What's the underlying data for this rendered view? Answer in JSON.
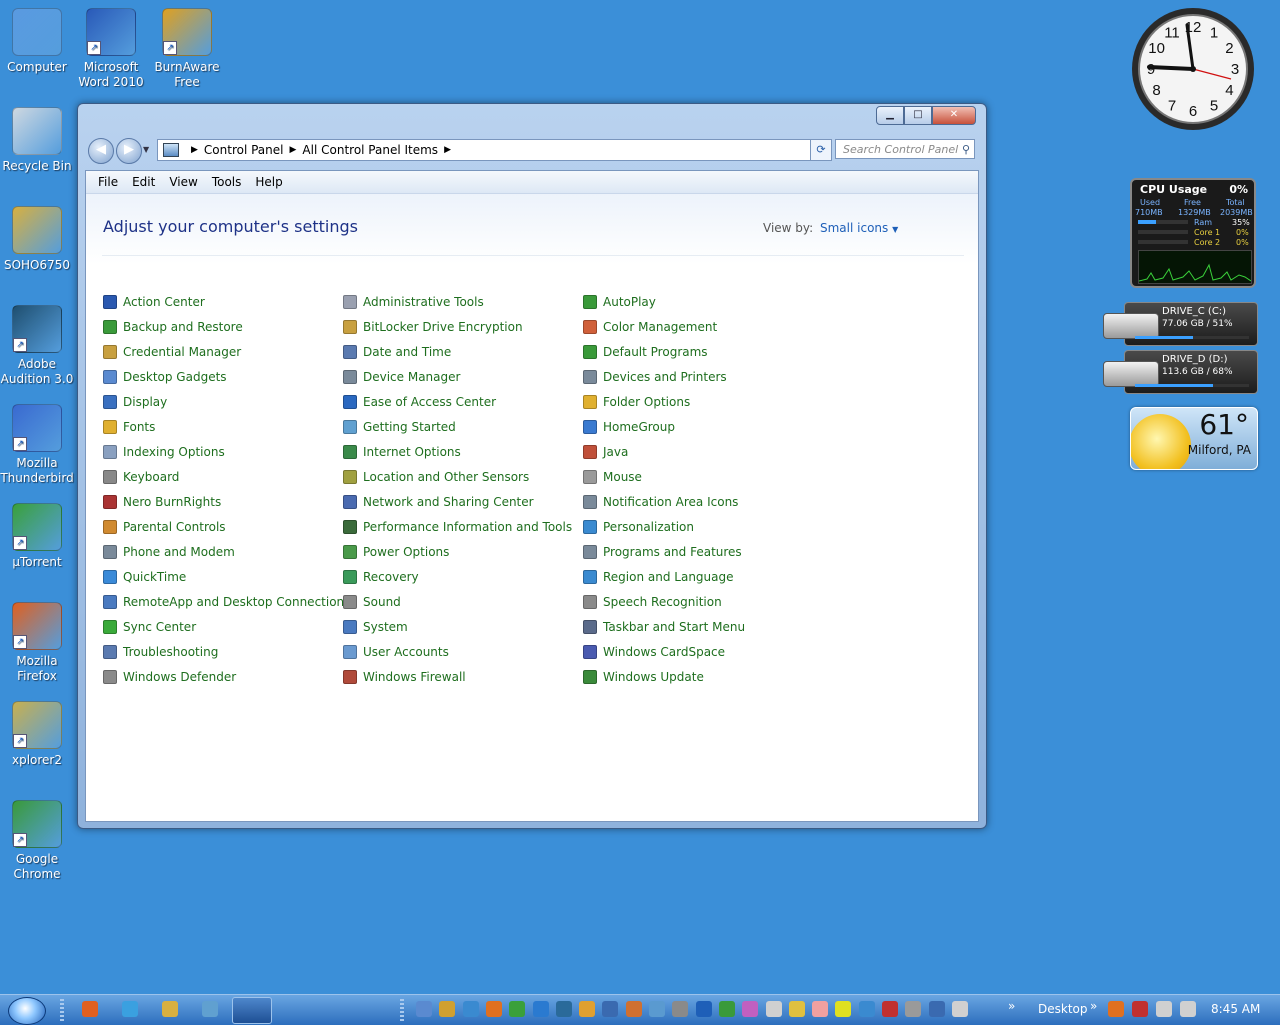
{
  "desktop_icons": [
    {
      "label": "Computer",
      "icon": "computer-icon",
      "shortcut": false
    },
    {
      "label": "Microsoft\nWord 2010",
      "icon": "word-icon",
      "shortcut": true
    },
    {
      "label": "BurnAware\nFree",
      "icon": "burnaware-icon",
      "shortcut": true
    },
    {
      "label": "Recycle Bin",
      "icon": "recycle-bin-icon",
      "shortcut": false
    },
    {
      "label": "SOHO6750",
      "icon": "user-folder-icon",
      "shortcut": false
    },
    {
      "label": "Adobe\nAudition 3.0",
      "icon": "audition-icon",
      "shortcut": true
    },
    {
      "label": "Mozilla\nThunderbird",
      "icon": "thunderbird-icon",
      "shortcut": true
    },
    {
      "label": "µTorrent",
      "icon": "utorrent-icon",
      "shortcut": true
    },
    {
      "label": "Mozilla\nFirefox",
      "icon": "firefox-icon",
      "shortcut": true
    },
    {
      "label": "xplorer2",
      "icon": "xplorer2-icon",
      "shortcut": true
    },
    {
      "label": "Google\nChrome",
      "icon": "chrome-icon",
      "shortcut": true
    }
  ],
  "window": {
    "controls": {
      "minimize": "▁",
      "maximize": "□",
      "close": "✕"
    },
    "breadcrumb": [
      "Control Panel",
      "All Control Panel Items"
    ],
    "search_placeholder": "Search Control Panel",
    "menu": [
      "File",
      "Edit",
      "View",
      "Tools",
      "Help"
    ],
    "heading": "Adjust your computer's settings",
    "view_by_label": "View by:",
    "view_by_value": "Small icons",
    "columns": [
      [
        {
          "label": "Action Center",
          "color": "#2a58b0"
        },
        {
          "label": "Backup and Restore",
          "color": "#3a9a3a"
        },
        {
          "label": "Credential Manager",
          "color": "#c8a040"
        },
        {
          "label": "Desktop Gadgets",
          "color": "#5a8ad0"
        },
        {
          "label": "Display",
          "color": "#3a70c0"
        },
        {
          "label": "Fonts",
          "color": "#e0b030"
        },
        {
          "label": "Indexing Options",
          "color": "#8aa0c0"
        },
        {
          "label": "Keyboard",
          "color": "#888888"
        },
        {
          "label": "Nero BurnRights",
          "color": "#aa3333"
        },
        {
          "label": "Parental Controls",
          "color": "#d08a30"
        },
        {
          "label": "Phone and Modem",
          "color": "#7a8a9a"
        },
        {
          "label": "QuickTime",
          "color": "#3a8ad8"
        },
        {
          "label": "RemoteApp and Desktop Connections",
          "color": "#4a7ac0"
        },
        {
          "label": "Sync Center",
          "color": "#3aaa3a"
        },
        {
          "label": "Troubleshooting",
          "color": "#5a7ab0"
        },
        {
          "label": "Windows Defender",
          "color": "#8a8a8a"
        }
      ],
      [
        {
          "label": "Administrative Tools",
          "color": "#9aa0b0"
        },
        {
          "label": "BitLocker Drive Encryption",
          "color": "#c8a040"
        },
        {
          "label": "Date and Time",
          "color": "#5a7ab0"
        },
        {
          "label": "Device Manager",
          "color": "#7a8a9a"
        },
        {
          "label": "Ease of Access Center",
          "color": "#2a68c0"
        },
        {
          "label": "Getting Started",
          "color": "#60a0d0"
        },
        {
          "label": "Internet Options",
          "color": "#3a8a4a"
        },
        {
          "label": "Location and Other Sensors",
          "color": "#a0a040"
        },
        {
          "label": "Network and Sharing Center",
          "color": "#4a6ab0"
        },
        {
          "label": "Performance Information and Tools",
          "color": "#3a6a3a"
        },
        {
          "label": "Power Options",
          "color": "#4a9a4a"
        },
        {
          "label": "Recovery",
          "color": "#3a9a5a"
        },
        {
          "label": "Sound",
          "color": "#8a8a8a"
        },
        {
          "label": "System",
          "color": "#4a7ac0"
        },
        {
          "label": "User Accounts",
          "color": "#6a9ad0"
        },
        {
          "label": "Windows Firewall",
          "color": "#b04a3a"
        }
      ],
      [
        {
          "label": "AutoPlay",
          "color": "#3a9a3a"
        },
        {
          "label": "Color Management",
          "color": "#d0603a"
        },
        {
          "label": "Default Programs",
          "color": "#3a9a3a"
        },
        {
          "label": "Devices and Printers",
          "color": "#7a8a9a"
        },
        {
          "label": "Folder Options",
          "color": "#e0b030"
        },
        {
          "label": "HomeGroup",
          "color": "#3a7ad0"
        },
        {
          "label": "Java",
          "color": "#c0503a"
        },
        {
          "label": "Mouse",
          "color": "#9a9a9a"
        },
        {
          "label": "Notification Area Icons",
          "color": "#7a8a9a"
        },
        {
          "label": "Personalization",
          "color": "#3a8ad0"
        },
        {
          "label": "Programs and Features",
          "color": "#7a8a9a"
        },
        {
          "label": "Region and Language",
          "color": "#3a8ad0"
        },
        {
          "label": "Speech Recognition",
          "color": "#8a8a8a"
        },
        {
          "label": "Taskbar and Start Menu",
          "color": "#5a6a8a"
        },
        {
          "label": "Windows CardSpace",
          "color": "#4a5ab0"
        },
        {
          "label": "Windows Update",
          "color": "#3a8a3a"
        }
      ]
    ]
  },
  "gadgets": {
    "clock": {
      "numbers": [
        "12",
        "1",
        "2",
        "3",
        "4",
        "5",
        "6",
        "7",
        "8",
        "9",
        "10",
        "11"
      ]
    },
    "cpu": {
      "title": "CPU Usage",
      "percent": "0%",
      "headers": [
        "Used",
        "Free",
        "Total"
      ],
      "values": [
        "710MB",
        "1329MB",
        "2039MB"
      ],
      "ram_label": "Ram",
      "ram_value": "35%",
      "core1_label": "Core 1",
      "core1_value": "0%",
      "core2_label": "Core 2",
      "core2_value": "0%"
    },
    "drives": [
      {
        "name": "DRIVE_C (C:)",
        "stats": "77.06 GB / 51%",
        "used_fraction": 0.51
      },
      {
        "name": "DRIVE_D (D:)",
        "stats": "113.6 GB / 68%",
        "used_fraction": 0.68
      }
    ],
    "weather": {
      "temp": "61°",
      "city": "Milford, PA"
    }
  },
  "taskbar": {
    "desktop_label": "Desktop",
    "chevron": "»",
    "time": "8:45 AM",
    "quicklaunch_colors": [
      "#e06020",
      "#3aa0e0",
      "#d8b040",
      "#60a0d0"
    ],
    "tray_colors": [
      "#5a8ad0",
      "#d0a030",
      "#3a8ad0",
      "#e07020",
      "#3aa03a",
      "#2a7ad0",
      "#2a6a9a",
      "#e0a030",
      "#3a6ab0",
      "#d07030",
      "#5a9ad0",
      "#8a8a8a",
      "#1e5fb8",
      "#3a9a3a",
      "#c060c0",
      "#d0d0d0",
      "#e0c040",
      "#f0a0a0",
      "#e0e020",
      "#3a8ad0",
      "#c03030",
      "#9a9a9a",
      "#3a6ab0",
      "#d0d0d0"
    ]
  }
}
